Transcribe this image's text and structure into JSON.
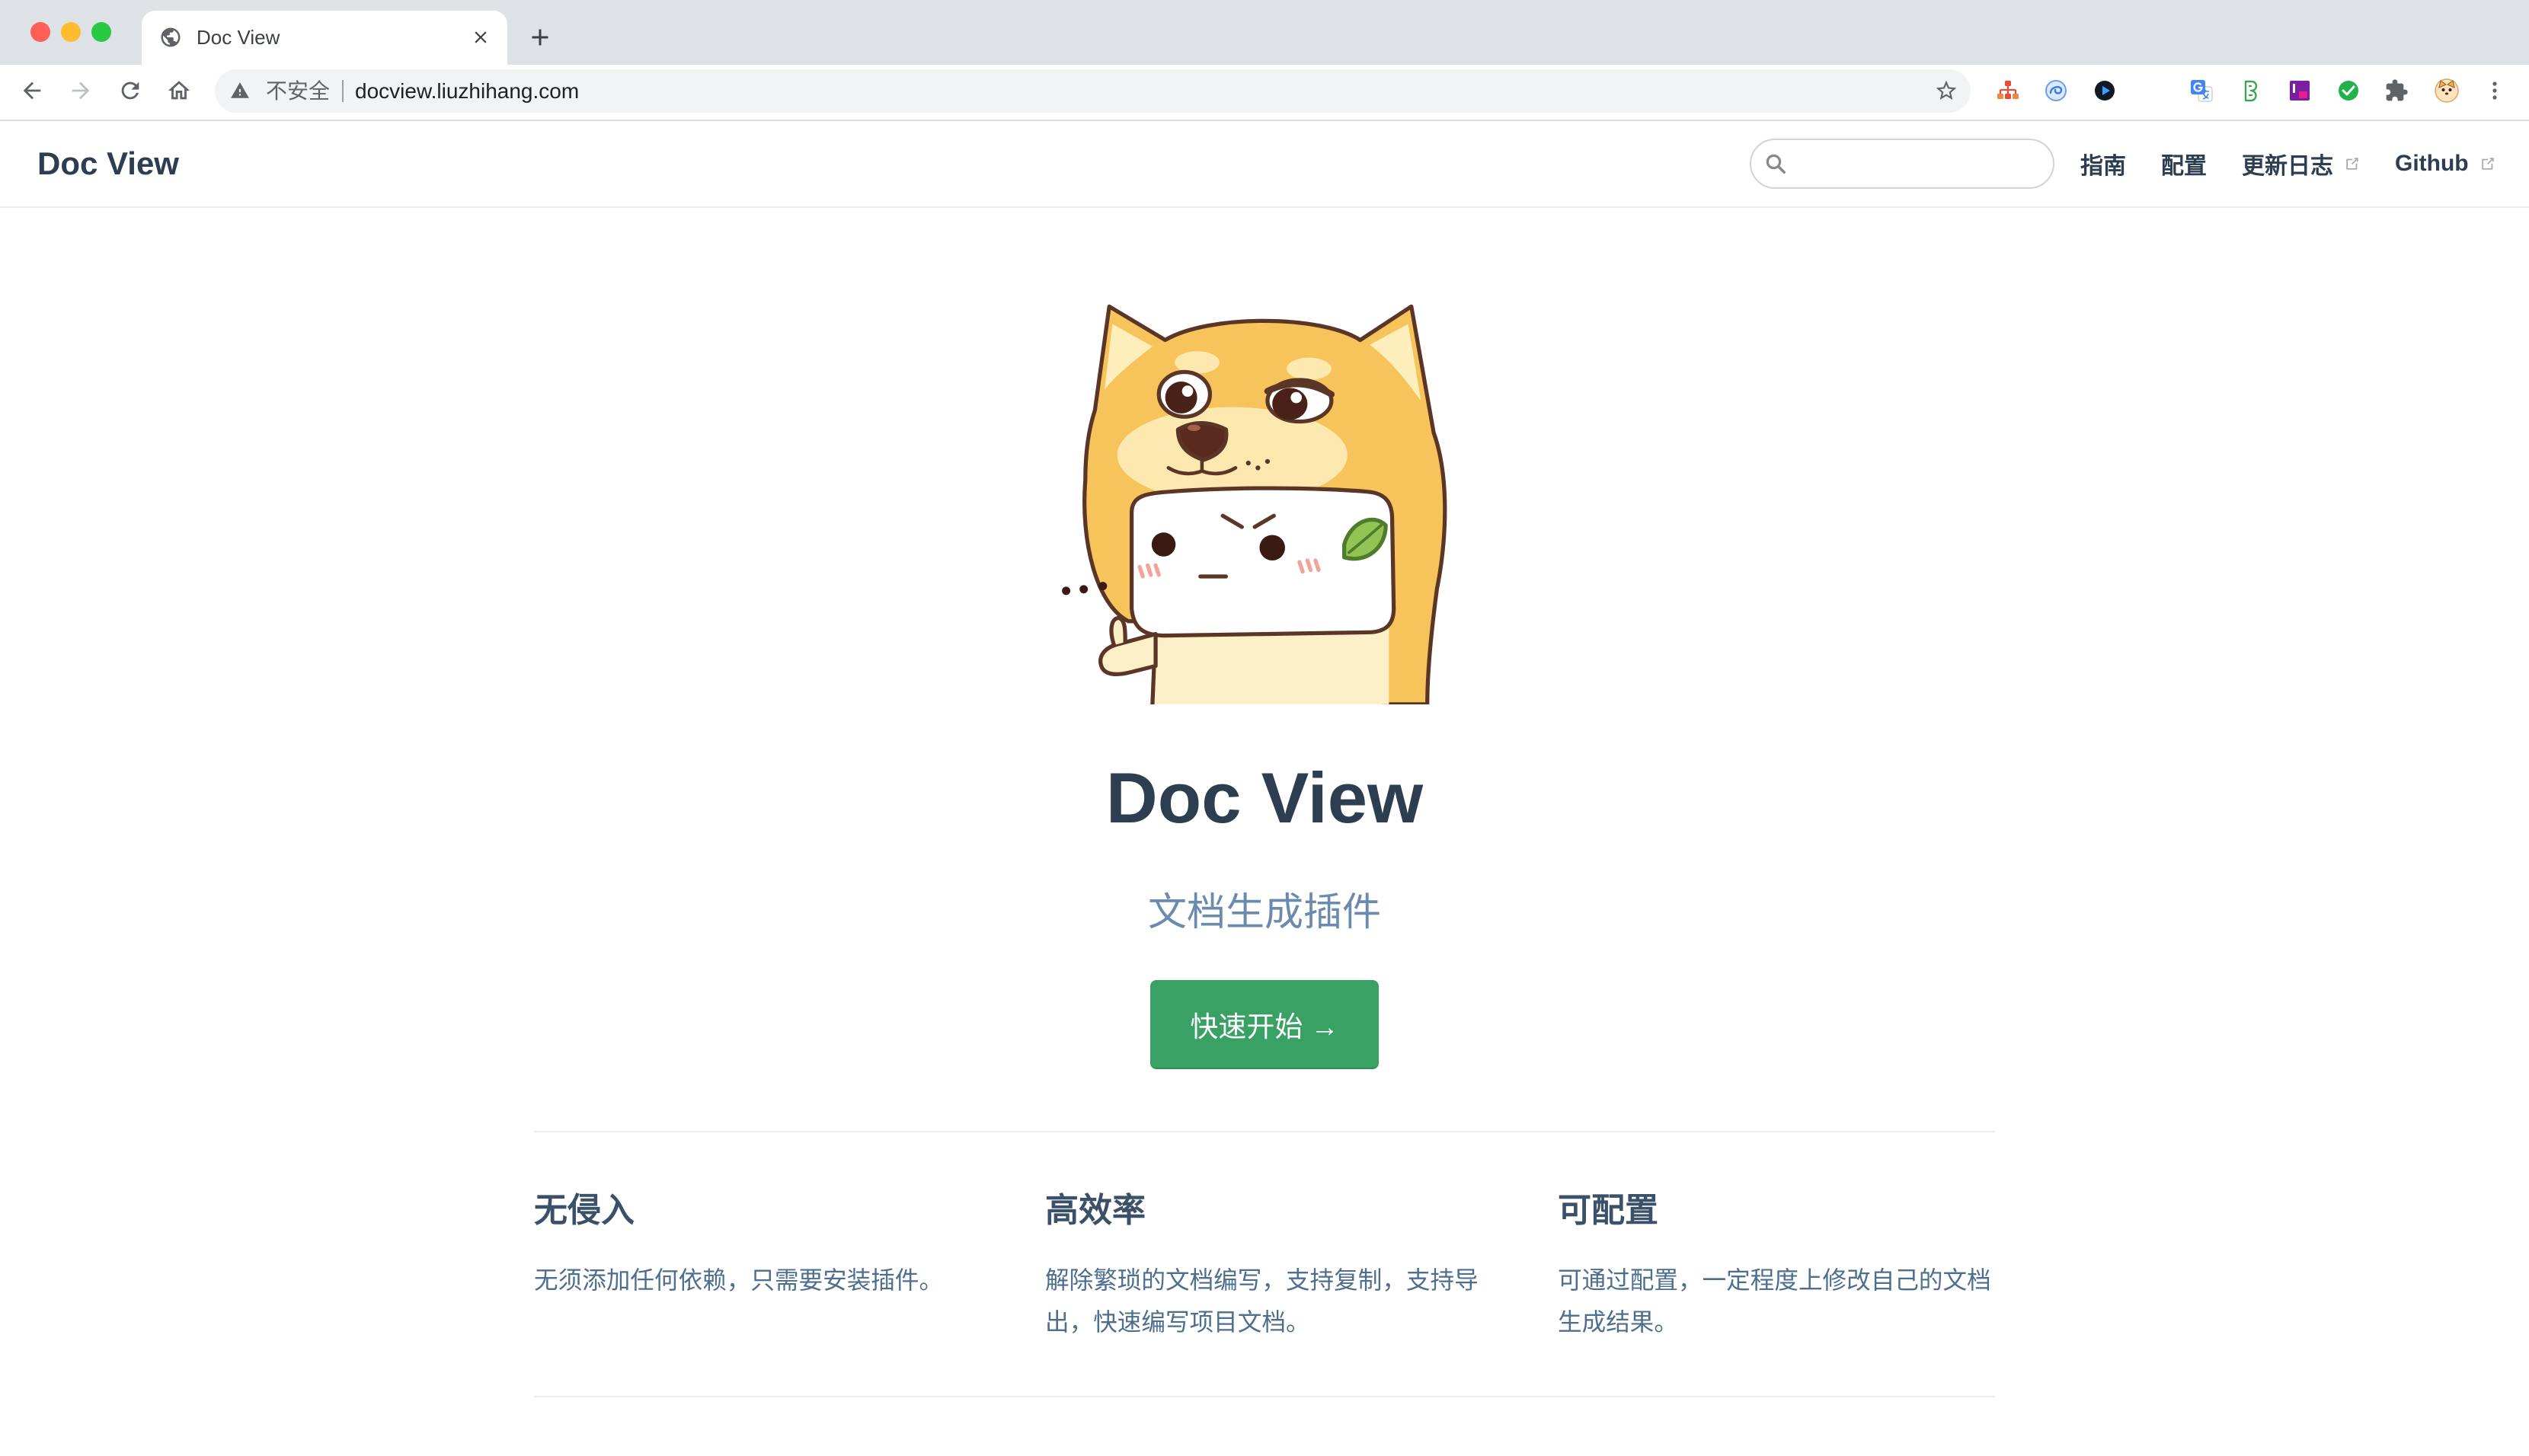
{
  "browser": {
    "window_controls": {
      "close_color": "#ff5f57",
      "minimize_color": "#febc2e",
      "zoom_color": "#28c840"
    },
    "tab": {
      "title": "Doc View",
      "favicon": "globe-icon",
      "close_icon": "close-icon"
    },
    "new_tab_icon": "plus-icon",
    "navigation_icons": [
      "back-arrow-icon",
      "forward-arrow-icon",
      "reload-icon",
      "home-icon"
    ],
    "omnibox": {
      "security_icon": "warning-icon",
      "security_label": "不安全",
      "url": "docview.liuzhihang.com",
      "bookmark_icon": "star-icon"
    },
    "extension_icons": [
      "sitemap-extension-icon",
      "blue-swirl-extension-icon",
      "play-circle-extension-icon",
      "google-translate-icon",
      "green-b-extension-icon",
      "purple-square-extension-icon",
      "check-circle-extension-icon",
      "extensions-puzzle-icon",
      "profile-avatar-icon",
      "kebab-menu-icon"
    ]
  },
  "site": {
    "brand": "Doc View",
    "search_icon": "search-icon",
    "nav": [
      {
        "label": "指南",
        "external": false
      },
      {
        "label": "配置",
        "external": false
      },
      {
        "label": "更新日志",
        "external": true
      },
      {
        "label": "Github",
        "external": true
      }
    ]
  },
  "hero": {
    "title": "Doc View",
    "description": "文档生成插件",
    "action_label": "快速开始 →"
  },
  "features": [
    {
      "title": "无侵入",
      "details": "无须添加任何依赖，只需要安装插件。"
    },
    {
      "title": "高效率",
      "details": "解除繁琐的文档编写，支持复制，支持导出，快速编写项目文档。"
    },
    {
      "title": "可配置",
      "details": "可通过配置，一定程度上修改自己的文档生成结果。"
    }
  ],
  "colors": {
    "text": "#2c3e50",
    "description": "#6a8bad",
    "feature_title": "#3a5169",
    "feature_text": "#4e6e8e",
    "accent": "#3aa164",
    "divider": "#eaecef"
  }
}
